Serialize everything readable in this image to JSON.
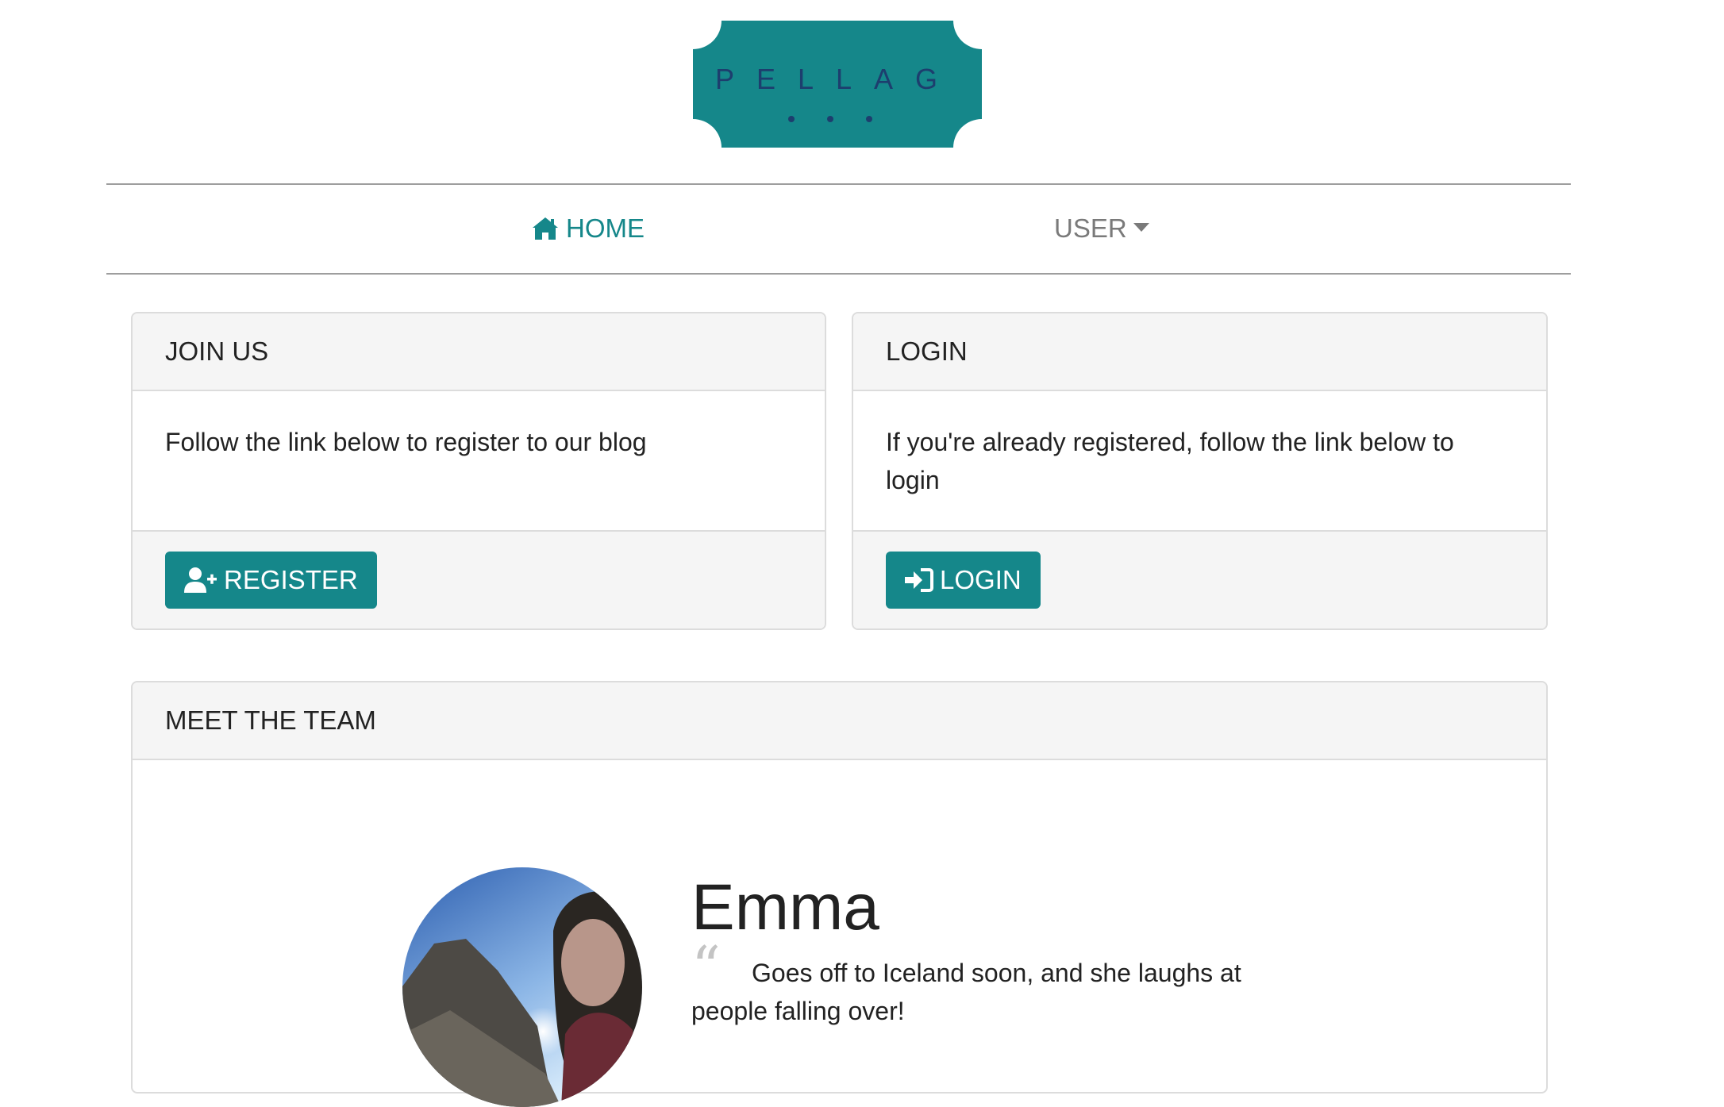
{
  "brand": {
    "logo_text": "PELLAG",
    "logo_color": "#15878a"
  },
  "nav": {
    "home_label": "HOME",
    "home_icon": "home-icon",
    "user_label": "USER"
  },
  "join_card": {
    "title": "JOIN US",
    "body": "Follow the link below to register to our blog",
    "button_label": "REGISTER",
    "button_icon": "user-plus-icon"
  },
  "login_card": {
    "title": "LOGIN",
    "body": "If you're already registered, follow the link below to login",
    "button_label": "LOGIN",
    "button_icon": "sign-in-icon"
  },
  "team_card": {
    "title": "MEET THE TEAM",
    "members": [
      {
        "name": "Emma",
        "quote": "Goes off to Iceland soon, and she laughs at people falling over!"
      }
    ]
  },
  "colors": {
    "accent": "#15878a",
    "card_header_bg": "#f5f5f5",
    "muted_nav": "#7a7a7a"
  }
}
